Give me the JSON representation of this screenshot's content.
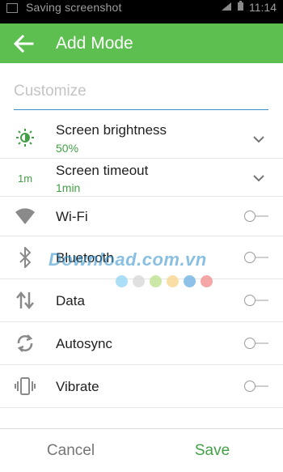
{
  "status_bar": {
    "notification_text": "Saving screenshot",
    "time": "11:14"
  },
  "toolbar": {
    "title": "Add Mode",
    "back_icon": "arrow-left-icon",
    "color": "#5cbf50"
  },
  "name_input": {
    "placeholder": "Customize",
    "value": ""
  },
  "settings": [
    {
      "id": "screen-brightness",
      "label": "Screen brightness",
      "value": "50%",
      "icon": "brightness-icon",
      "control": "dropdown"
    },
    {
      "id": "screen-timeout",
      "label": "Screen timeout",
      "value": "1min",
      "icon_text": "1m",
      "control": "dropdown"
    },
    {
      "id": "wifi",
      "label": "Wi-Fi",
      "icon": "wifi-icon",
      "control": "toggle",
      "on": false
    },
    {
      "id": "bluetooth",
      "label": "Bluetooth",
      "icon": "bluetooth-icon",
      "control": "toggle",
      "on": false
    },
    {
      "id": "data",
      "label": "Data",
      "icon": "data-arrows-icon",
      "control": "toggle",
      "on": false
    },
    {
      "id": "autosync",
      "label": "Autosync",
      "icon": "sync-icon",
      "control": "toggle",
      "on": false
    },
    {
      "id": "vibrate",
      "label": "Vibrate",
      "icon": "vibrate-icon",
      "control": "toggle",
      "on": false
    }
  ],
  "footer": {
    "cancel_label": "Cancel",
    "save_label": "Save"
  },
  "watermark": {
    "text": "Download.com.vn",
    "dot_colors": [
      "#8fd3f4",
      "#d6d6d6",
      "#b9e08a",
      "#f7d488",
      "#6aaee0",
      "#f28a8a"
    ]
  }
}
